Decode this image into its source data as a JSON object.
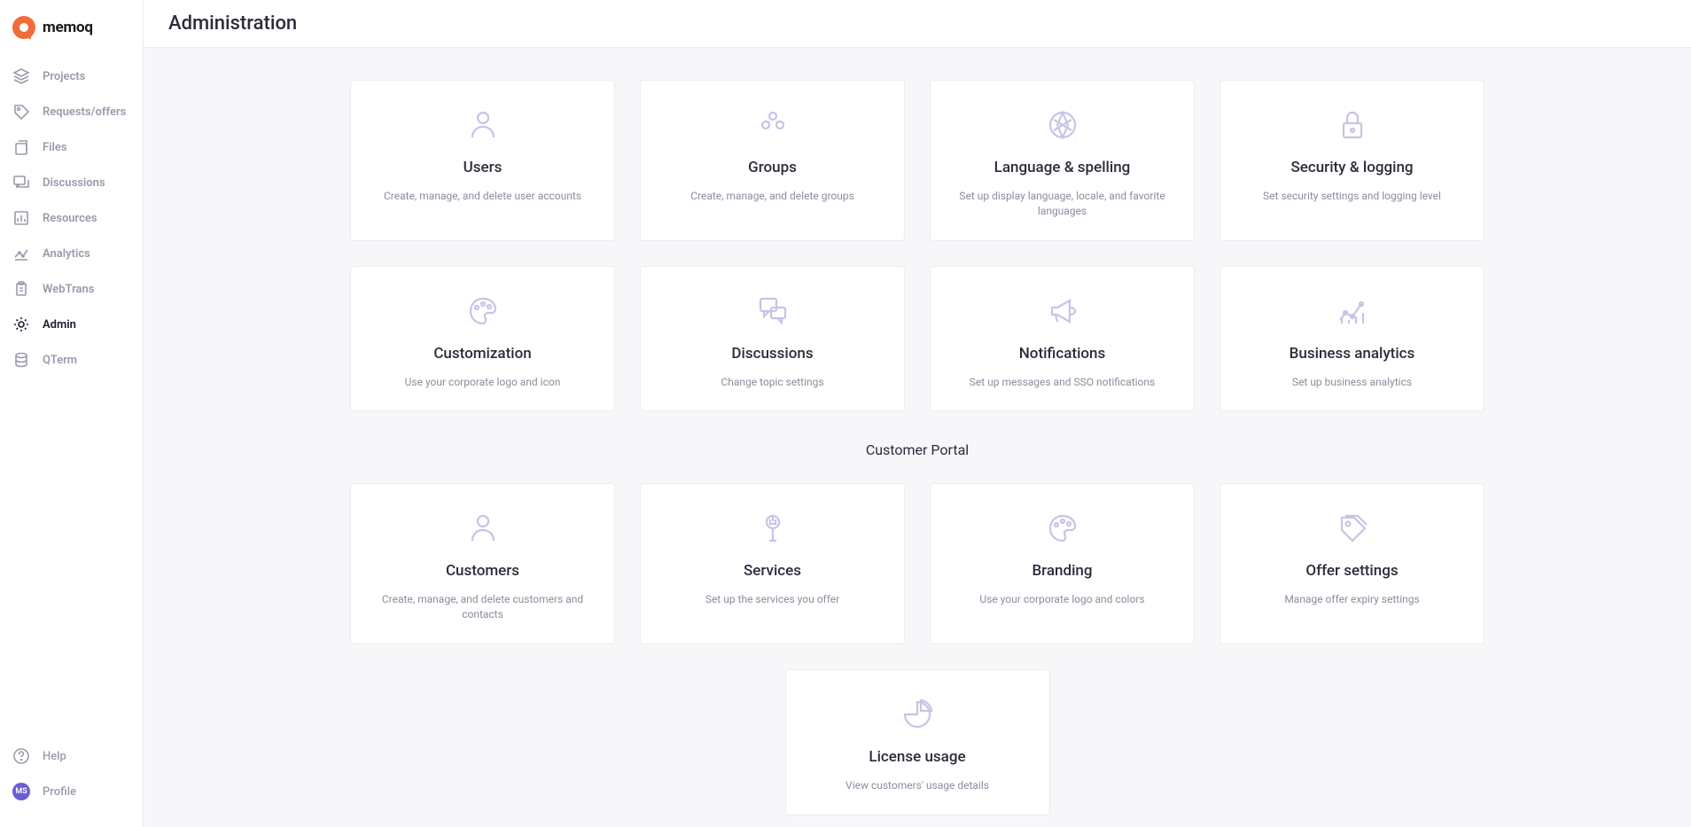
{
  "brand": {
    "name": "memoq"
  },
  "header": {
    "title": "Administration"
  },
  "sidebar": {
    "items": [
      {
        "id": "projects",
        "label": "Projects",
        "icon": "layers-icon",
        "active": false
      },
      {
        "id": "requests",
        "label": "Requests/offers",
        "icon": "tag-icon",
        "active": false
      },
      {
        "id": "files",
        "label": "Files",
        "icon": "files-icon",
        "active": false
      },
      {
        "id": "discussions",
        "label": "Discussions",
        "icon": "chat-icon",
        "active": false
      },
      {
        "id": "resources",
        "label": "Resources",
        "icon": "chart-icon",
        "active": false
      },
      {
        "id": "analytics",
        "label": "Analytics",
        "icon": "trend-icon",
        "active": false
      },
      {
        "id": "webtrans",
        "label": "WebTrans",
        "icon": "clipboard-icon",
        "active": false
      },
      {
        "id": "admin",
        "label": "Admin",
        "icon": "gear-icon",
        "active": true
      },
      {
        "id": "qterm",
        "label": "QTerm",
        "icon": "database-icon",
        "active": false
      }
    ],
    "bottom": [
      {
        "id": "help",
        "label": "Help",
        "icon": "help-icon"
      },
      {
        "id": "profile",
        "label": "Profile",
        "icon": "avatar",
        "initials": "MS"
      }
    ]
  },
  "sections": [
    {
      "title": null,
      "cards": [
        {
          "id": "users",
          "icon": "user-icon",
          "title": "Users",
          "desc": "Create, manage, and delete user accounts"
        },
        {
          "id": "groups",
          "icon": "group-icon",
          "title": "Groups",
          "desc": "Create, manage, and delete groups"
        },
        {
          "id": "language",
          "icon": "globe-icon",
          "title": "Language & spelling",
          "desc": "Set up display language, locale, and favorite languages"
        },
        {
          "id": "security",
          "icon": "lock-icon",
          "title": "Security & logging",
          "desc": "Set security settings and logging level"
        },
        {
          "id": "customization",
          "icon": "palette-icon",
          "title": "Customization",
          "desc": "Use your corporate logo and icon"
        },
        {
          "id": "discussions",
          "icon": "discuss-icon",
          "title": "Discussions",
          "desc": "Change topic settings"
        },
        {
          "id": "notifications",
          "icon": "megaphone-icon",
          "title": "Notifications",
          "desc": "Set up messages and SSO notifications"
        },
        {
          "id": "biz-analytics",
          "icon": "analytics-icon",
          "title": "Business analytics",
          "desc": "Set up business analytics"
        }
      ]
    },
    {
      "title": "Customer Portal",
      "cards": [
        {
          "id": "customers",
          "icon": "user-icon",
          "title": "Customers",
          "desc": "Create, manage, and delete customers and contacts"
        },
        {
          "id": "services",
          "icon": "wrench-icon",
          "title": "Services",
          "desc": "Set up the services you offer"
        },
        {
          "id": "branding",
          "icon": "palette-icon",
          "title": "Branding",
          "desc": "Use your corporate logo and colors"
        },
        {
          "id": "offer-settings",
          "icon": "tags-icon",
          "title": "Offer settings",
          "desc": "Manage offer expiry settings"
        }
      ]
    },
    {
      "title": null,
      "cards": [
        {
          "id": "license",
          "icon": "pie-icon",
          "title": "License usage",
          "desc": "View customers' usage details"
        }
      ]
    }
  ]
}
